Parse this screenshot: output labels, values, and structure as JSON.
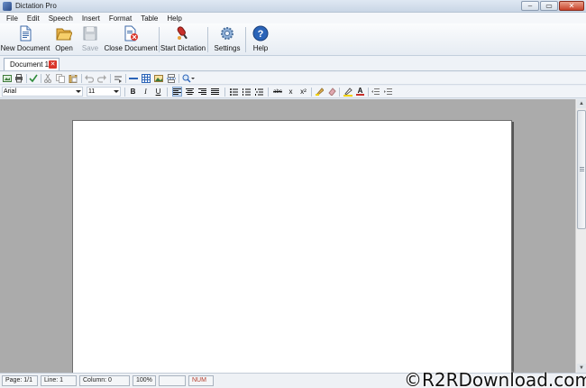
{
  "window": {
    "title": "Dictation Pro",
    "controls": {
      "minimize": "‒",
      "maximize": "▭",
      "close": "✕"
    }
  },
  "menu": [
    "File",
    "Edit",
    "Speech",
    "Insert",
    "Format",
    "Table",
    "Help"
  ],
  "ribbon": {
    "buttons": [
      {
        "label": "New Document",
        "icon": "new-document-icon",
        "enabled": true
      },
      {
        "label": "Open",
        "icon": "folder-open-icon",
        "enabled": true
      },
      {
        "label": "Save",
        "icon": "save-icon",
        "enabled": false
      },
      {
        "label": "Close Document",
        "icon": "close-document-icon",
        "enabled": true
      },
      {
        "label": "Start Dictation",
        "icon": "microphone-icon",
        "enabled": true
      },
      {
        "label": "Settings",
        "icon": "gear-icon",
        "enabled": true
      },
      {
        "label": "Help",
        "icon": "help-icon",
        "enabled": true
      }
    ]
  },
  "tabs": [
    {
      "label": "Document 1",
      "active": true,
      "close_glyph": "✕"
    }
  ],
  "toolbar": {
    "font": "Arial",
    "size": "11",
    "format_buttons": {
      "bold": "B",
      "italic": "I",
      "underline": "U",
      "strikethrough": "abc",
      "subscript": "x",
      "superscript": "x²",
      "font_color": "A"
    },
    "active_alignment": "align-left"
  },
  "status": {
    "page": "Page: 1/1",
    "line": "Line: 1",
    "column": "Column: 0",
    "zoom": "100%",
    "blank": "",
    "num": "NUM"
  },
  "watermark": "©R2RDownload.com",
  "colors": {
    "workspace": "#ababab",
    "page": "#ffffff",
    "accent": "#2b64b8",
    "num_text": "#b23a2a"
  }
}
